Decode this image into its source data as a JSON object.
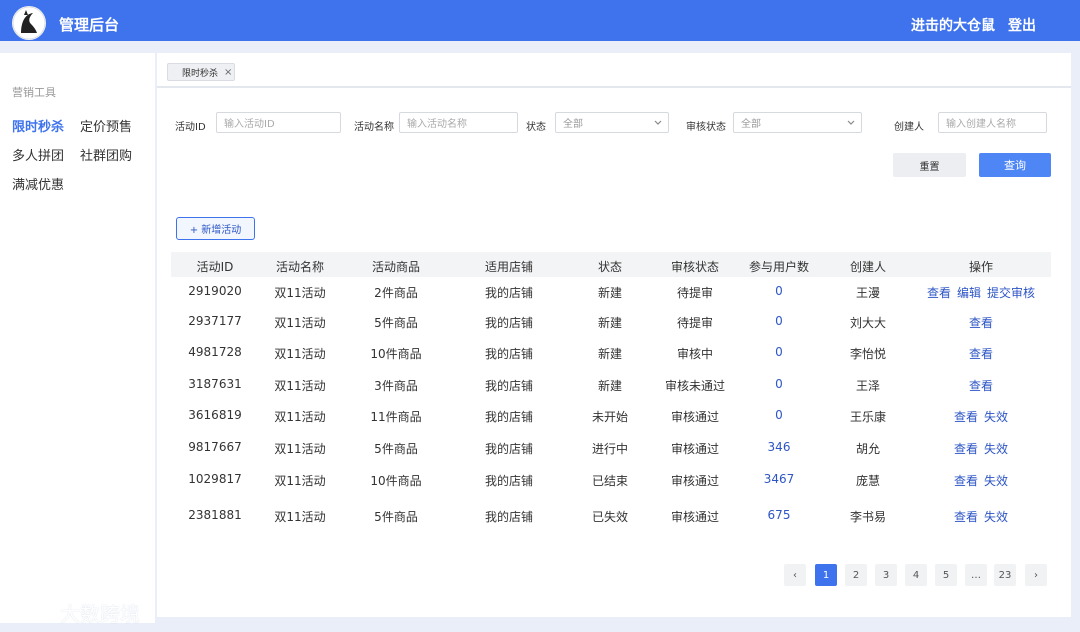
{
  "header": {
    "brand": "管理后台",
    "user": "进击的大仓鼠",
    "logout": "登出"
  },
  "sidebar": {
    "group": "营销工具",
    "items": [
      {
        "label": "限时秒杀",
        "active": true
      },
      {
        "label": "定价预售"
      },
      {
        "label": "多人拼团"
      },
      {
        "label": "社群团购"
      },
      {
        "label": "满减优惠"
      }
    ]
  },
  "tabs": [
    {
      "label": "限时秒杀",
      "close": "×"
    }
  ],
  "filters": {
    "activity_id": {
      "label": "活动ID",
      "placeholder": "输入活动ID"
    },
    "activity_name": {
      "label": "活动名称",
      "placeholder": "输入活动名称"
    },
    "status": {
      "label": "状态",
      "value": "全部"
    },
    "audit_status": {
      "label": "审核状态",
      "value": "全部"
    },
    "creator": {
      "label": "创建人",
      "placeholder": "输入创建人名称"
    }
  },
  "buttons": {
    "reset": "重置",
    "search": "查询",
    "add": "+ 新增活动"
  },
  "table": {
    "headers": [
      "活动ID",
      "活动名称",
      "活动商品",
      "适用店铺",
      "状态",
      "审核状态",
      "参与用户数",
      "创建人",
      "操作"
    ],
    "rows": [
      {
        "id": "2919020",
        "name": "双11活动",
        "goods": "2件商品",
        "shop": "我的店铺",
        "status": "新建",
        "audit": "待提审",
        "users": "0",
        "creator": "王漫",
        "actions": [
          "查看",
          "编辑",
          "提交审核"
        ]
      },
      {
        "id": "2937177",
        "name": "双11活动",
        "goods": "5件商品",
        "shop": "我的店铺",
        "status": "新建",
        "audit": "待提审",
        "users": "0",
        "creator": "刘大大",
        "actions": [
          "查看"
        ]
      },
      {
        "id": "4981728",
        "name": "双11活动",
        "goods": "10件商品",
        "shop": "我的店铺",
        "status": "新建",
        "audit": "审核中",
        "users": "0",
        "creator": "李怡悦",
        "actions": [
          "查看"
        ]
      },
      {
        "id": "3187631",
        "name": "双11活动",
        "goods": "3件商品",
        "shop": "我的店铺",
        "status": "新建",
        "audit": "审核未通过",
        "users": "0",
        "creator": "王泽",
        "actions": [
          "查看"
        ]
      },
      {
        "id": "3616819",
        "name": "双11活动",
        "goods": "11件商品",
        "shop": "我的店铺",
        "status": "未开始",
        "audit": "审核通过",
        "users": "0",
        "creator": "王乐康",
        "actions": [
          "查看",
          "失效"
        ]
      },
      {
        "id": "9817667",
        "name": "双11活动",
        "goods": "5件商品",
        "shop": "我的店铺",
        "status": "进行中",
        "audit": "审核通过",
        "users": "346",
        "creator": "胡允",
        "actions": [
          "查看",
          "失效"
        ]
      },
      {
        "id": "1029817",
        "name": "双11活动",
        "goods": "10件商品",
        "shop": "我的店铺",
        "status": "已结束",
        "audit": "审核通过",
        "users": "3467",
        "creator": "庞慧",
        "actions": [
          "查看",
          "失效"
        ]
      },
      {
        "id": "2381881",
        "name": "双11活动",
        "goods": "5件商品",
        "shop": "我的店铺",
        "status": "已失效",
        "audit": "审核通过",
        "users": "675",
        "creator": "李书易",
        "actions": [
          "查看",
          "失效"
        ]
      }
    ]
  },
  "pagination": {
    "prev": "‹",
    "pages": [
      "1",
      "2",
      "3",
      "4",
      "5",
      "…",
      "23"
    ],
    "current": "1",
    "next": "›"
  },
  "watermark": "大数跨境",
  "colors": {
    "primary": "#3f73ee",
    "link": "#2d55c5",
    "page_bg": "#e9eef8"
  }
}
